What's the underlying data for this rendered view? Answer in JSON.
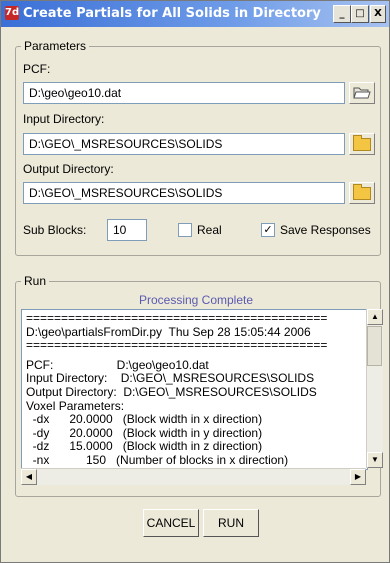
{
  "window": {
    "title": "Create Partials for All Solids in Directory",
    "app_icon": "7d",
    "min": "_",
    "max": "□",
    "close": "X"
  },
  "parameters": {
    "legend": "Parameters",
    "pcf_label": "PCF:",
    "pcf_value": "D:\\geo\\geo10.dat",
    "input_label": "Input Directory:",
    "input_value": "D:\\GEO\\_MSRESOURCES\\SOLIDS",
    "output_label": "Output Directory:",
    "output_value": "D:\\GEO\\_MSRESOURCES\\SOLIDS",
    "subblocks_label": "Sub Blocks:",
    "subblocks_value": "10",
    "real_label": "Real",
    "real_checked": false,
    "save_label": "Save Responses",
    "save_checked": true
  },
  "run": {
    "legend": "Run",
    "status": "Processing Complete",
    "log_lines": [
      "===========================================",
      "D:\\geo\\partialsFromDir.py  Thu Sep 28 15:05:44 2006",
      "===========================================",
      "PCF:                   D:\\geo\\geo10.dat",
      "Input Directory:    D:\\GEO\\_MSRESOURCES\\SOLIDS",
      "Output Directory:  D:\\GEO\\_MSRESOURCES\\SOLIDS",
      "Voxel Parameters:",
      "  -dx      20.0000   (Block width in x direction)",
      "  -dy      20.0000   (Block width in y direction)",
      "  -dz      15.0000   (Block width in z direction)",
      "  -nx           150   (Number of blocks in x direction)"
    ]
  },
  "buttons": {
    "cancel": "CANCEL",
    "run": "RUN"
  }
}
